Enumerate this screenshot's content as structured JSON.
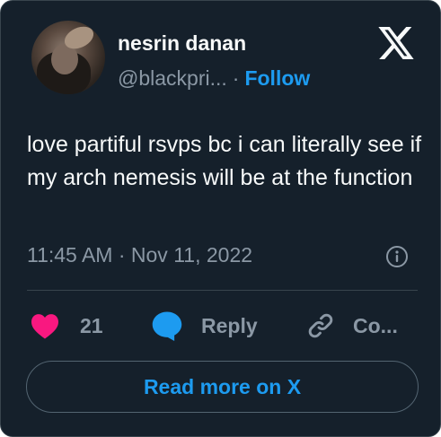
{
  "author": {
    "name": "nesrin danan",
    "handle": "@blackpri...",
    "separator": "·",
    "follow_label": "Follow"
  },
  "brand": {
    "logo_icon": "x-logo-icon"
  },
  "tweet": {
    "text": "love partiful rsvps bc i can literally see if my arch nemesis will be at the function",
    "timestamp": "11:45 AM · Nov 11, 2022"
  },
  "actions": {
    "like_count": "21",
    "reply_label": "Reply",
    "copy_label": "Co..."
  },
  "footer": {
    "read_more_label": "Read more on X"
  },
  "colors": {
    "background": "#15202b",
    "text": "#f7f9f9",
    "muted": "#8b98a5",
    "accent": "#1d9bf0",
    "like": "#f91880",
    "border": "#38444d"
  }
}
